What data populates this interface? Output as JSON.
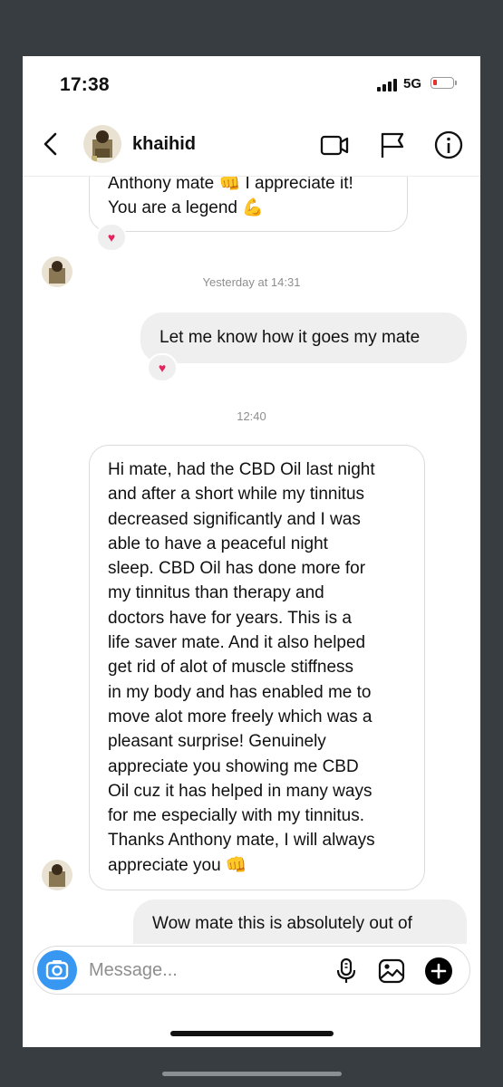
{
  "status": {
    "time": "17:38",
    "network": "5G"
  },
  "header": {
    "username": "khaihid"
  },
  "messages": {
    "top_partial": "Anthony mate 👊 I appreciate it!\nYou are a legend 💪",
    "stamp1": "Yesterday at 14:31",
    "out1": "Let me know how it goes my mate",
    "stamp2": "12:40",
    "long_in": "Hi mate, had the CBD Oil last night\nand after a short while my tinnitus\ndecreased significantly and I was\nable to have a peaceful night\nsleep. CBD Oil has done more for\nmy tinnitus than therapy and\ndoctors have for years. This is a\nlife saver mate. And it also helped\nget rid of alot of muscle stiffness\nin my body and has enabled me to\nmove alot more freely which was a\npleasant surprise! Genuinely\nappreciate you showing me CBD\nOil cuz it has helped in many ways\nfor me especially with my tinnitus.\nThanks Anthony mate, I will always\nappreciate you 👊",
    "out2_partial": "Wow mate this is absolutely out of"
  },
  "reactions": {
    "heart": "♥"
  },
  "composer": {
    "placeholder": "Message..."
  },
  "colors": {
    "camera": "#3897f0",
    "heart": "#e0245e",
    "battery_low": "#e0332e"
  }
}
